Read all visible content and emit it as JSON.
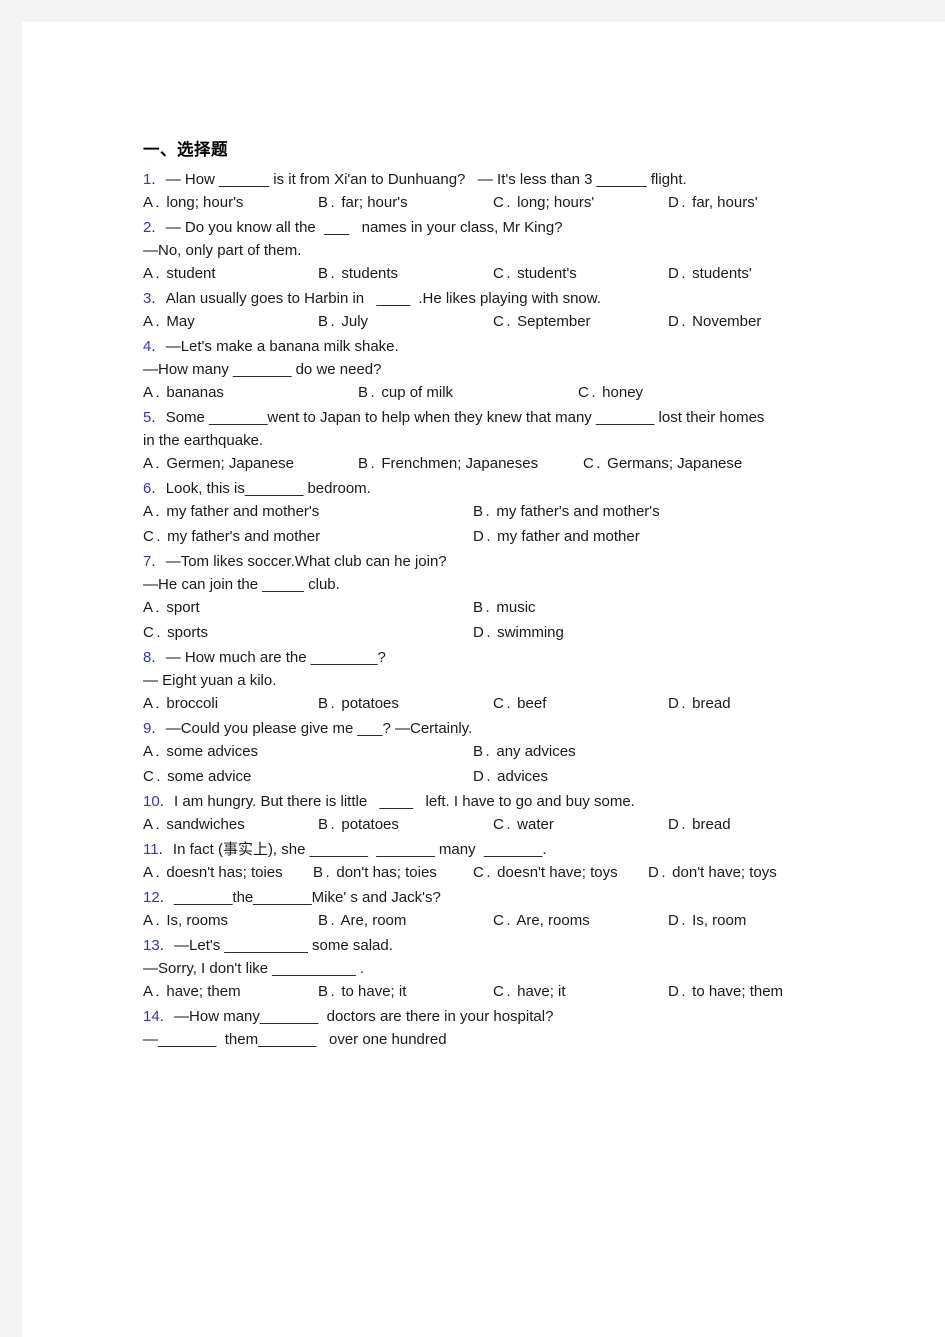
{
  "document": {
    "section_title": "一、选择题",
    "page_background": "#ffffff",
    "outer_background": "#f4f4f4",
    "number_color": "#3333cc",
    "text_color": "#1a1a1a"
  },
  "questions": [
    {
      "number": "1.",
      "stem_lines": [
        "— How ______ is it from Xi'an to Dunhuang?   — It's less than 3 ______ flight."
      ],
      "options": [
        {
          "letter": "A.",
          "text": "long; hour's"
        },
        {
          "letter": "B.",
          "text": "far; hour's"
        },
        {
          "letter": "C.",
          "text": "long; hours'"
        },
        {
          "letter": "D.",
          "text": "far, hours'"
        }
      ],
      "option_layout": "four-column"
    },
    {
      "number": "2.",
      "stem_lines": [
        "— Do you know all the  ___   names in your class, Mr King?",
        "—No, only part of them."
      ],
      "options": [
        {
          "letter": "A.",
          "text": "student"
        },
        {
          "letter": "B.",
          "text": "students"
        },
        {
          "letter": "C.",
          "text": "student's"
        },
        {
          "letter": "D.",
          "text": "students'"
        }
      ],
      "option_layout": "four-column"
    },
    {
      "number": "3.",
      "stem_lines": [
        "Alan usually goes to Harbin in   ____  .He likes playing with snow."
      ],
      "options": [
        {
          "letter": "A.",
          "text": "May"
        },
        {
          "letter": "B.",
          "text": "July"
        },
        {
          "letter": "C.",
          "text": "September"
        },
        {
          "letter": "D.",
          "text": "November"
        }
      ],
      "option_layout": "four-column"
    },
    {
      "number": "4.",
      "stem_lines": [
        "—Let's make a banana milk shake.",
        "—How many _______ do we need?"
      ],
      "options": [
        {
          "letter": "A.",
          "text": "bananas"
        },
        {
          "letter": "B.",
          "text": "cup of milk"
        },
        {
          "letter": "C.",
          "text": "honey"
        }
      ],
      "option_layout": "three-column"
    },
    {
      "number": "5.",
      "stem_lines": [
        "Some _______went to Japan to help when they knew that many _______ lost their homes",
        "in the earthquake."
      ],
      "options": [
        {
          "letter": "A.",
          "text": "Germen; Japanese"
        },
        {
          "letter": "B.",
          "text": "Frenchmen; Japaneses"
        },
        {
          "letter": "C.",
          "text": "Germans; Japanese"
        }
      ],
      "option_layout": "three-column-wide"
    },
    {
      "number": "6.",
      "stem_lines": [
        "Look, this is_______ bedroom."
      ],
      "options": [
        {
          "letter": "A.",
          "text": "my father and mother's"
        },
        {
          "letter": "B.",
          "text": "my father's and mother's"
        },
        {
          "letter": "C.",
          "text": "my father's and mother"
        },
        {
          "letter": "D.",
          "text": "my father and mother"
        }
      ],
      "option_layout": "two-column"
    },
    {
      "number": "7.",
      "stem_lines": [
        "—Tom likes soccer.What club can he join?",
        "—He can join the _____ club."
      ],
      "options": [
        {
          "letter": "A.",
          "text": "sport"
        },
        {
          "letter": "B.",
          "text": "music"
        },
        {
          "letter": "C.",
          "text": "sports"
        },
        {
          "letter": "D.",
          "text": "swimming"
        }
      ],
      "option_layout": "two-column"
    },
    {
      "number": "8.",
      "stem_lines": [
        "— How much are the ________?",
        "— Eight yuan a kilo."
      ],
      "options": [
        {
          "letter": "A.",
          "text": "broccoli"
        },
        {
          "letter": "B.",
          "text": "potatoes"
        },
        {
          "letter": "C.",
          "text": "beef"
        },
        {
          "letter": "D.",
          "text": "bread"
        }
      ],
      "option_layout": "four-column"
    },
    {
      "number": "9.",
      "stem_lines": [
        "—Could you please give me ___? —Certainly."
      ],
      "options": [
        {
          "letter": "A.",
          "text": "some advices"
        },
        {
          "letter": "B.",
          "text": "any advices"
        },
        {
          "letter": "C.",
          "text": "some advice"
        },
        {
          "letter": "D.",
          "text": "advices"
        }
      ],
      "option_layout": "two-column"
    },
    {
      "number": "10.",
      "stem_lines": [
        "I am hungry. But there is little   ____   left. I have to go and buy some."
      ],
      "options": [
        {
          "letter": "A.",
          "text": "sandwiches"
        },
        {
          "letter": "B.",
          "text": "potatoes"
        },
        {
          "letter": "C.",
          "text": "water"
        },
        {
          "letter": "D.",
          "text": "bread"
        }
      ],
      "option_layout": "four-column"
    },
    {
      "number": "11.",
      "stem_lines": [
        "In fact (事实上), she _______  _______ many  _______."
      ],
      "options": [
        {
          "letter": "A.",
          "text": "doesn't has; toies"
        },
        {
          "letter": "B.",
          "text": "don't has; toies"
        },
        {
          "letter": "C.",
          "text": "doesn't have; toys"
        },
        {
          "letter": "D.",
          "text": "don't have; toys"
        }
      ],
      "option_layout": "four-column-tight"
    },
    {
      "number": "12.",
      "stem_lines": [
        "_______the_______Mike' s and Jack's?"
      ],
      "options": [
        {
          "letter": "A.",
          "text": "Is, rooms"
        },
        {
          "letter": "B.",
          "text": "Are, room"
        },
        {
          "letter": "C.",
          "text": "Are, rooms"
        },
        {
          "letter": "D.",
          "text": "Is, room"
        }
      ],
      "option_layout": "four-column"
    },
    {
      "number": "13.",
      "stem_lines": [
        "—Let's __________ some salad.",
        "—Sorry, I don't like __________ ."
      ],
      "options": [
        {
          "letter": "A.",
          "text": "have; them"
        },
        {
          "letter": "B.",
          "text": "to have; it"
        },
        {
          "letter": "C.",
          "text": "have; it"
        },
        {
          "letter": "D.",
          "text": "to have; them"
        }
      ],
      "option_layout": "four-column"
    },
    {
      "number": "14.",
      "stem_lines": [
        "—How many_______  doctors are there in your hospital?",
        "—_______  them_______   over one hundred"
      ],
      "options": [],
      "option_layout": "none"
    }
  ]
}
